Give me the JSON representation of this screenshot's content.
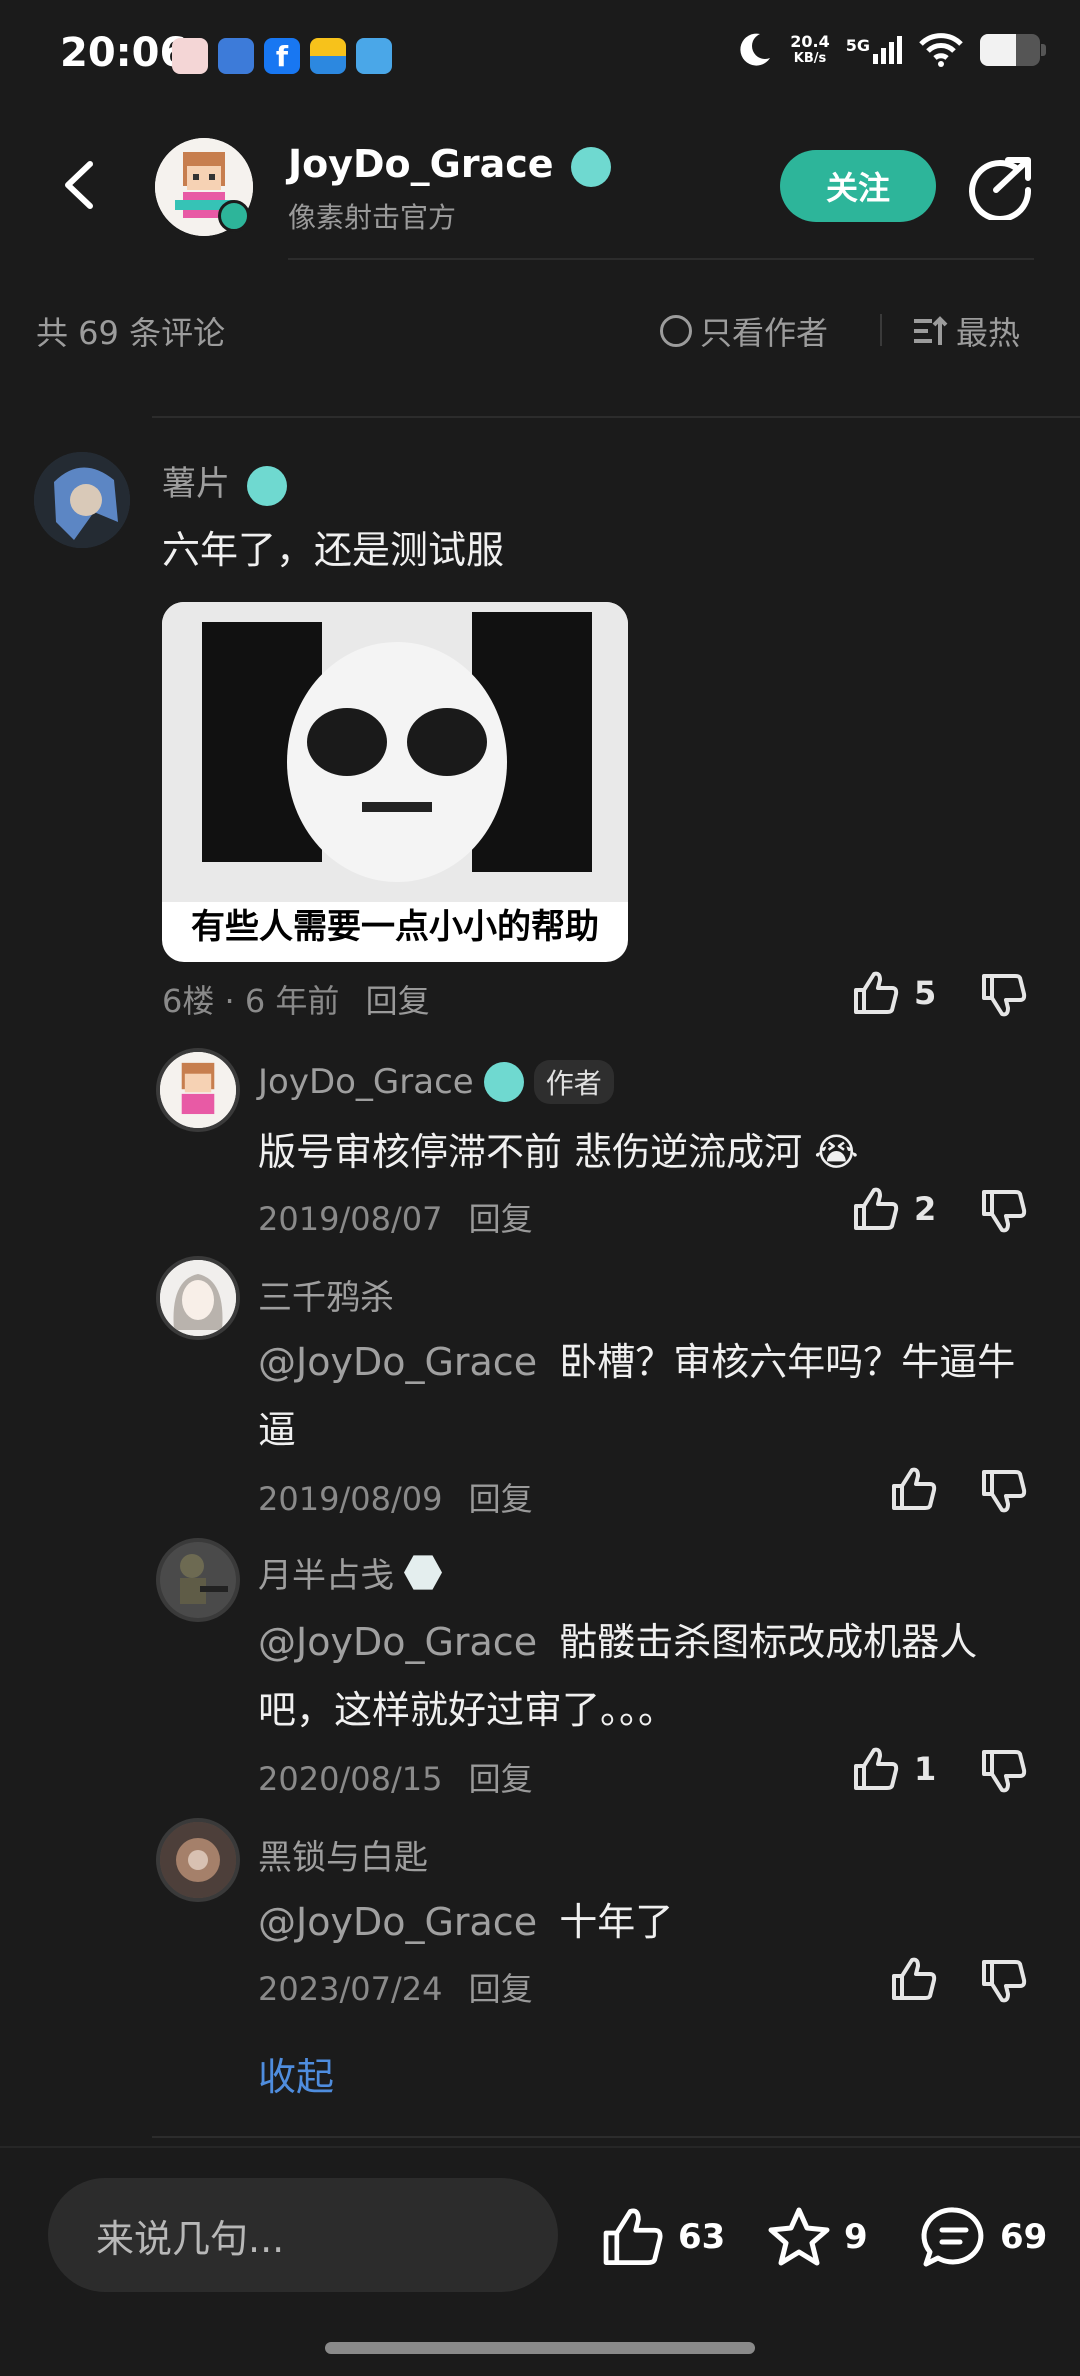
{
  "status": {
    "time": "20:06",
    "speed": "20.4",
    "speed_unit": "KB/s",
    "network": "5G"
  },
  "header": {
    "name": "JoyDo_Grace",
    "subtitle": "像素射击官方",
    "follow_label": "关注"
  },
  "comments_header": {
    "count_label": "共 69 条评论",
    "only_author_label": "只看作者",
    "sort_label": "最热"
  },
  "main_comment": {
    "user": "薯片",
    "text": "六年了，还是测试服",
    "image_caption": "有些人需要一点小小的帮助",
    "floor_time": "6楼 · 6 年前",
    "reply_label": "回复",
    "likes": "5"
  },
  "replies": [
    {
      "user": "JoyDo_Grace",
      "tag": "作者",
      "text": "版号审核停滞不前 悲伤逆流成河 😭",
      "date": "2019/08/07",
      "reply_label": "回复",
      "likes": "2"
    },
    {
      "user": "三千鸦杀",
      "mention": "@JoyDo_Grace",
      "text": "卧槽？审核六年吗？牛逼牛逼",
      "date": "2019/08/09",
      "reply_label": "回复",
      "likes": ""
    },
    {
      "user": "月半占戋",
      "mention": "@JoyDo_Grace",
      "text": "骷髅击杀图标改成机器人吧，这样就好过审了。。。",
      "date": "2020/08/15",
      "reply_label": "回复",
      "likes": "1"
    },
    {
      "user": "黑锁与白匙",
      "mention": "@JoyDo_Grace",
      "text": "十年了",
      "date": "2023/07/24",
      "reply_label": "回复",
      "likes": ""
    }
  ],
  "collapse_label": "收起",
  "bottom": {
    "input_placeholder": "来说几句...",
    "likes": "63",
    "favorites": "9",
    "comments": "69"
  },
  "colors": {
    "background": "#1b1b1b",
    "accent": "#2db59a",
    "link": "#4f8dde",
    "badge": "#6fd9d0"
  }
}
